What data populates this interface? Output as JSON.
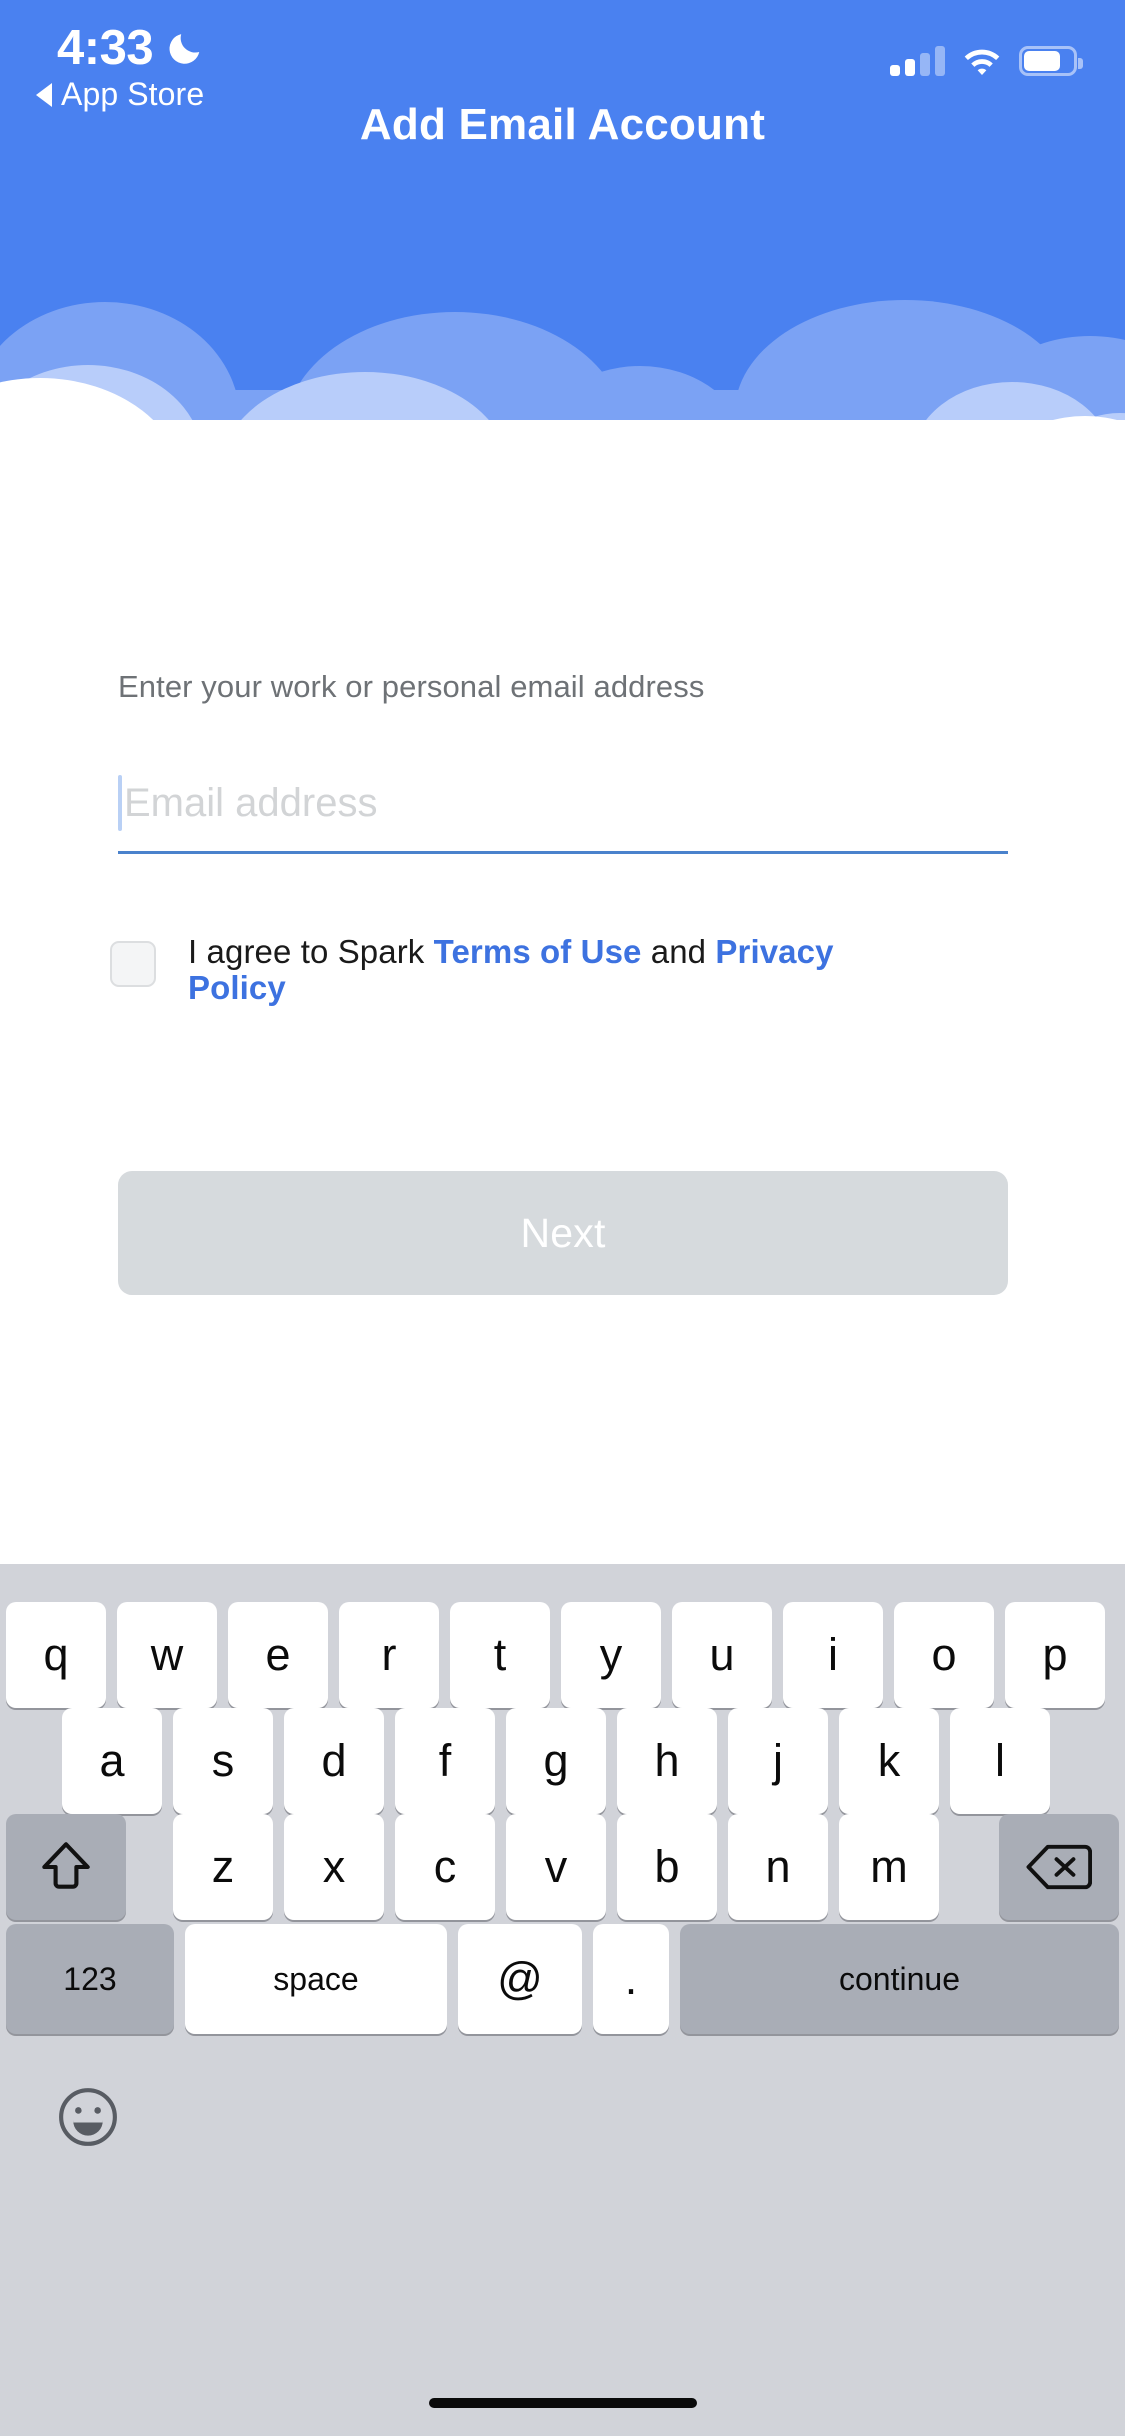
{
  "status_bar": {
    "time": "4:33",
    "dnd_icon": "moon-icon",
    "back_label": "App Store",
    "back_icon": "back-triangle-icon",
    "signal_icon": "cellular-signal-icon",
    "signal_bars_filled": 2,
    "signal_bars_total": 4,
    "wifi_icon": "wifi-icon",
    "battery_icon": "battery-icon",
    "battery_level_pct": 62
  },
  "header": {
    "title": "Add Email Account",
    "background_color": "#4a81f0",
    "cloud_colors": {
      "mid": "#7ba2f4",
      "light": "#b8cdfa",
      "white": "#ffffff"
    }
  },
  "form": {
    "field_label": "Enter your work or personal email address",
    "email": {
      "value": "",
      "placeholder": "Email address",
      "underline_color": "#4a82cc",
      "caret_color": "#b9d0f5"
    },
    "agreement": {
      "checked": false,
      "prefix": "I agree to Spark ",
      "terms_link": "Terms of Use",
      "middle": " and ",
      "privacy_link": "Privacy Policy",
      "link_color": "#3d72e0"
    },
    "next_button": {
      "label": "Next",
      "enabled": false,
      "background_color": "#d6dadd",
      "text_color": "#ffffff"
    }
  },
  "keyboard": {
    "background_color": "#d1d3d9",
    "key_color": "#ffffff",
    "modifier_key_color": "#a9adb6",
    "row1": [
      "q",
      "w",
      "e",
      "r",
      "t",
      "y",
      "u",
      "i",
      "o",
      "p"
    ],
    "row2": [
      "a",
      "s",
      "d",
      "f",
      "g",
      "h",
      "j",
      "k",
      "l"
    ],
    "row3_letters": [
      "z",
      "x",
      "c",
      "v",
      "b",
      "n",
      "m"
    ],
    "shift_icon": "shift-arrow-icon",
    "backspace_icon": "backspace-icon",
    "row4": {
      "numbers_label": "123",
      "space_label": "space",
      "at_label": "@",
      "period_label": ".",
      "continue_label": "continue"
    },
    "emoji_icon": "emoji-smiley-icon"
  },
  "home_indicator": "home-indicator"
}
